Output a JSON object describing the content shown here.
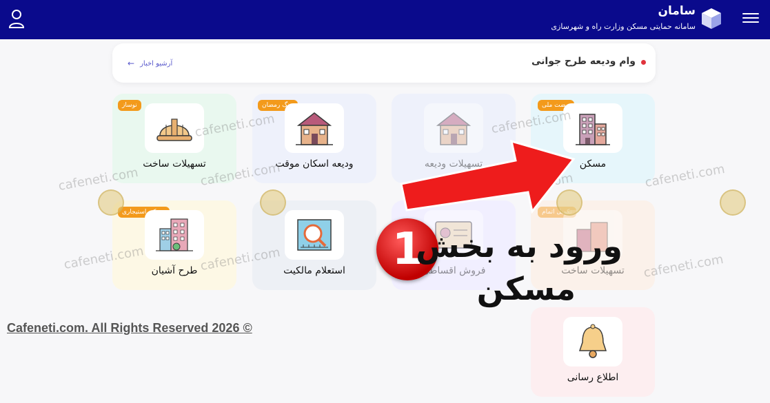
{
  "header": {
    "title": "سامان",
    "subtitle": "سامانه حمایتی مسکن وزارت راه و شهرسازی",
    "menu_icon": "hamburger-icon",
    "user_icon": "user-icon",
    "bg_color": "#0a0a8c"
  },
  "news": {
    "title": "وام ودیعه طرح جوانی",
    "archive_label": "آرشیو اخبار"
  },
  "cards": [
    {
      "label": "مسکن",
      "badge": "نهضت ملی",
      "icon": "building-icon"
    },
    {
      "label": "تسهیلات ودیعه",
      "badge": "",
      "icon": "house-icon"
    },
    {
      "label": "ودیعه اسکان موقت",
      "badge": "جنگ رمضان",
      "icon": "house-icon"
    },
    {
      "label": "تسهیلات ساخت",
      "badge": "نوساز",
      "icon": "hard-hat-icon"
    },
    {
      "label": "تسهیلات ساخت",
      "badge": "تکمیل اتمام",
      "icon": "buildings-icon"
    },
    {
      "label": "فروش اقساطی",
      "badge": "",
      "icon": "contract-icon"
    },
    {
      "label": "استعلام مالکیت",
      "badge": "",
      "icon": "magnifier-icon"
    },
    {
      "label": "طرح آشیان",
      "badge": "مسکن استیجاری",
      "icon": "apartment-icon"
    },
    {
      "label": "اطلاع رسانی",
      "badge": "",
      "icon": "bell-icon"
    }
  ],
  "watermark": "cafeneti.com",
  "copyright": "Cafeneti.com. All Rights Reserved 2026 ©",
  "overlay": {
    "step_number": "1",
    "line1": "ورود به بخش",
    "line2": "مسکن",
    "arrow_color": "#ee1c1c"
  }
}
